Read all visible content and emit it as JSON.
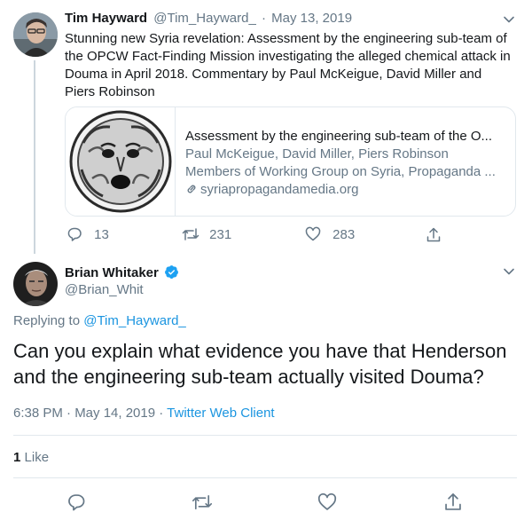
{
  "parent_tweet": {
    "author_name": "Tim Hayward",
    "author_handle": "@Tim_Hayward_",
    "separator": "·",
    "date": "May 13, 2019",
    "text": "Stunning new Syria revelation: Assessment by the engineering sub-team of the OPCW Fact-Finding Mission investigating the alleged chemical attack in Douma in April 2018. Commentary by Paul McKeigue, David Miller and Piers Robinson",
    "card": {
      "title": "Assessment by the engineering sub-team of the O...",
      "line1": "Paul McKeigue, David Miller, Piers Robinson",
      "line2": "Members of Working Group on Syria, Propaganda ...",
      "domain": "syriapropagandamedia.org"
    },
    "actions": {
      "replies": "13",
      "retweets": "231",
      "likes": "283"
    }
  },
  "main_tweet": {
    "author_name": "Brian Whitaker",
    "author_handle": "@Brian_Whit",
    "replying_to_label": "Replying to",
    "replying_to_handle": "@Tim_Hayward_",
    "text": "Can you explain what evidence you have that Henderson and the engineering sub-team actually visited Douma?",
    "time": "6:38 PM · May 14, 2019 ·",
    "client": "Twitter Web Client",
    "like_count": "1",
    "like_label": "Like"
  },
  "colors": {
    "accent": "#1b95e0",
    "text": "#14171a",
    "muted": "#657786",
    "border": "#e1e8ed",
    "verified": "#1da1f2"
  }
}
